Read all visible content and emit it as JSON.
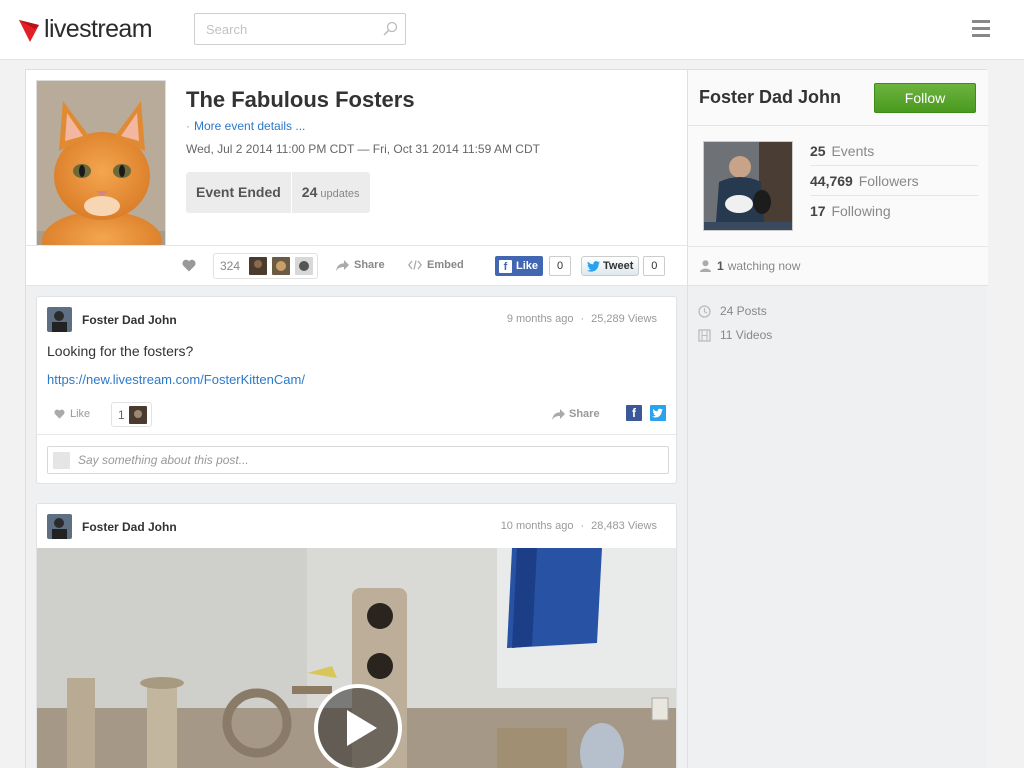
{
  "brand": {
    "logo_text": "livestream"
  },
  "search": {
    "placeholder": "Search"
  },
  "event": {
    "title": "The Fabulous Fosters",
    "more_details": "More event details ...",
    "dates": "Wed, Jul 2 2014 11:00 PM CDT — Fri, Oct 31 2014 11:59 AM CDT",
    "status": "Event Ended",
    "updates_count": "24",
    "updates_label": "updates",
    "likes_count": "324",
    "share_label": "Share",
    "embed_label": "Embed",
    "fb_like_label": "Like",
    "fb_like_count": "0",
    "tweet_label": "Tweet",
    "tweet_count": "0"
  },
  "host": {
    "name": "Foster Dad John",
    "follow_label": "Follow",
    "stats": [
      {
        "value": "25",
        "label": "Events"
      },
      {
        "value": "44,769",
        "label": "Followers"
      },
      {
        "value": "17",
        "label": "Following"
      }
    ],
    "watching_count": "1",
    "watching_label": "watching now",
    "posts_label": "24 Posts",
    "videos_label": "11 Videos"
  },
  "posts": [
    {
      "author": "Foster Dad John",
      "time": "9 months ago",
      "views": "25,289 Views",
      "text": "Looking for the fosters?",
      "link": "https://new.livestream.com/FosterKittenCam/",
      "like_label": "Like",
      "likes_count": "1",
      "share_label": "Share",
      "comment_placeholder": "Say something about this post..."
    },
    {
      "author": "Foster Dad John",
      "time": "10 months ago",
      "views": "28,483 Views"
    }
  ],
  "colors": {
    "brand_red": "#e21f26",
    "link_blue": "#2c78c9",
    "follow_green": "#5aa82e",
    "facebook": "#3b5998",
    "twitter": "#2aa3ef"
  },
  "icons": [
    "livestream-logo-icon",
    "search-icon",
    "menu-icon",
    "heart-icon",
    "share-icon",
    "embed-icon",
    "facebook-icon",
    "twitter-icon",
    "person-icon",
    "clock-icon",
    "film-icon",
    "play-icon"
  ]
}
